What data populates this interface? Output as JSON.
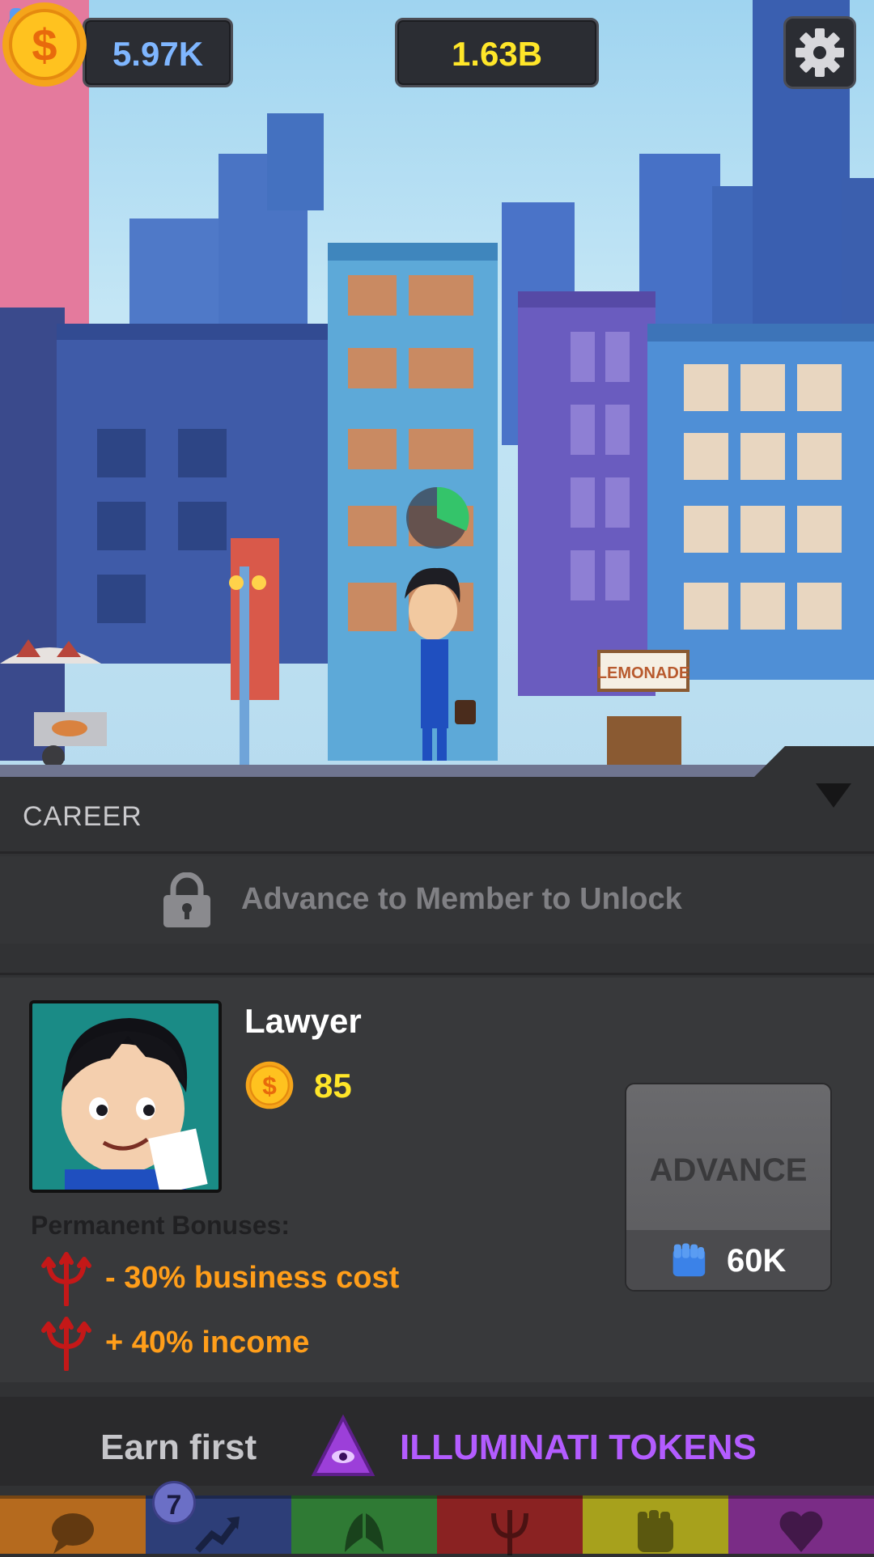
{
  "hud": {
    "power_value": "5.97K",
    "cash_value": "1.63B"
  },
  "scene": {
    "lemonade_sign": "LEMONADE"
  },
  "career": {
    "header": "CAREER",
    "locked_message": "Advance to Member to Unlock",
    "title": "Lawyer",
    "cost": "85",
    "bonus_title": "Permanent Bonuses:",
    "bonuses": [
      {
        "text": "- 30% business cost",
        "icon": "trident-icon"
      },
      {
        "text": "+ 40% income",
        "icon": "trident-icon"
      }
    ],
    "advance_label": "ADVANCE",
    "advance_cost": "60K"
  },
  "promo": {
    "earn_text": "Earn first",
    "tokens_text": "ILLUMINATI TOKENS"
  },
  "tabs": [
    {
      "name": "chat",
      "color": "#b56a1e",
      "icon": "speech-bubble-icon"
    },
    {
      "name": "career",
      "color": "#2d3e78",
      "icon": "trend-arrow-icon",
      "badge": "7"
    },
    {
      "name": "angel",
      "color": "#2f7a34",
      "icon": "wings-icon"
    },
    {
      "name": "devil",
      "color": "#8a2222",
      "icon": "trident-icon"
    },
    {
      "name": "power",
      "color": "#a7a11c",
      "icon": "fist-icon"
    },
    {
      "name": "love",
      "color": "#7a2c86",
      "icon": "heart-icon"
    }
  ],
  "colors": {
    "cash": "#ffe629",
    "power": "#7fb6ff",
    "bonus": "#ff9e1a",
    "illuminati": "#b35cff"
  }
}
